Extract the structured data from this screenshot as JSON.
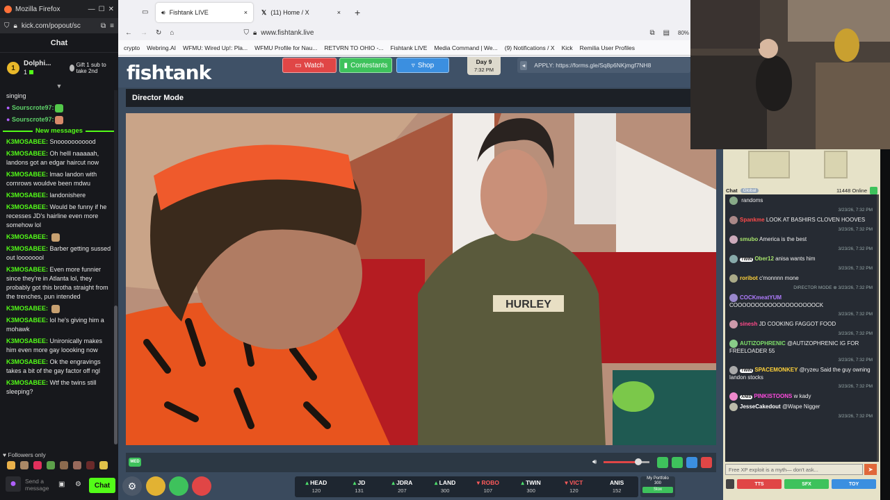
{
  "kick": {
    "window_title": "Mozilla Firefox",
    "url": "kick.com/popout/sc",
    "header": "Chat",
    "pinned": {
      "rank": "1",
      "user": "Dolphi...",
      "count": "1",
      "gift_text": "Gift 1 sub to take 2nd"
    },
    "pre_messages": [
      {
        "user": "",
        "text": "singing"
      },
      {
        "user": "Sourscrote97:",
        "text": ""
      },
      {
        "user": "Sourscrote97:",
        "text": ""
      }
    ],
    "new_messages_label": "New messages",
    "messages": [
      {
        "user": "K3MOSABEE:",
        "text": "Snooooooooood"
      },
      {
        "user": "K3MOSABEE:",
        "text": "Oh helll naaaaah, landons got an edgar haircut now"
      },
      {
        "user": "K3MOSABEE:",
        "text": "lmao landon with cornrows wouldve been mdwu"
      },
      {
        "user": "K3MOSABEE:",
        "text": "landonishere"
      },
      {
        "user": "K3MOSABEE:",
        "text": "Would be funny if he recesses JD's hairline even more somehow lol"
      },
      {
        "user": "K3MOSABEE:",
        "text": ""
      },
      {
        "user": "K3MOSABEE:",
        "text": "Barber getting sussed out loooooool"
      },
      {
        "user": "K3MOSABEE:",
        "text": "Even more funnier since they're in Atlanta lol, they probably got this brotha straight from the trenches, pun intended"
      },
      {
        "user": "K3MOSABEE:",
        "text": ""
      },
      {
        "user": "K3MOSABEE:",
        "text": "lol he's giving him a mohawk"
      },
      {
        "user": "K3MOSABEE:",
        "text": "Unironically makes him even more gay loooking now"
      },
      {
        "user": "K3MOSABEE:",
        "text": "Ok the engravings takes a bit of the gay factor off ngl"
      },
      {
        "user": "K3MOSABEE:",
        "text": "Wtf the twins still sleeping?"
      }
    ],
    "followers_only": "Followers only",
    "send_placeholder": "Send a message",
    "chat_button": "Chat"
  },
  "browser": {
    "tabs": [
      {
        "title": "Fishtank LIVE",
        "close": "×"
      },
      {
        "title": "(11) Home / X",
        "close": "×"
      }
    ],
    "new_tab": "+",
    "url": "www.fishtank.live",
    "zoom": "80%",
    "bookmarks": [
      "crypto",
      "Webring.AI",
      "WFMU: Wired Up!: Pla...",
      "WFMU Profile for Nau...",
      "RETVRN TO OHIO -...",
      "Fishtank LIVE",
      "Media Command | We...",
      "(9) Notifications / X",
      "Kick",
      "Remilia User Profiles"
    ]
  },
  "fishtank": {
    "logo": "fishtank",
    "nav": {
      "watch": "Watch",
      "contestants": "Contestants",
      "shop": "Shop"
    },
    "day": {
      "label": "Day 9",
      "date": "7:32 PM"
    },
    "apply": "APPLY: https://forms.gle/Sq8p6NKjmgf7NH8",
    "mode_title": "Director Mode",
    "quality": "MED",
    "contestants": [
      {
        "name": "HEAD",
        "value": "120",
        "dir": "up"
      },
      {
        "name": "JD",
        "value": "131",
        "dir": "up"
      },
      {
        "name": "JDRA",
        "value": "207",
        "dir": "up"
      },
      {
        "name": "LAND",
        "value": "300",
        "dir": "up"
      },
      {
        "name": "ROBO",
        "value": "107",
        "dir": "down"
      },
      {
        "name": "TWIN",
        "value": "300",
        "dir": "up"
      },
      {
        "name": "VICT",
        "value": "120",
        "dir": "down"
      },
      {
        "name": "ANIS",
        "value": "152",
        "dir": "none"
      }
    ],
    "portfolio": {
      "label": "My Portfolio",
      "value": "300",
      "button": "Stox"
    },
    "chat": {
      "title": "Chat",
      "tab": "Global",
      "online": "11448 Online",
      "messages": [
        {
          "badge": "",
          "user": "",
          "text": "randoms",
          "ts": "3/23/26, 7:32 PM",
          "color": "#ffffff"
        },
        {
          "badge": "",
          "user": "Spankme",
          "text": "LOOK AT BASHIRS CLOVEN HOOVES",
          "ts": "3/23/26, 7:32 PM",
          "color": "#ff4a4a"
        },
        {
          "badge": "",
          "user": "smubo",
          "text": "America is the best",
          "ts": "3/23/26, 7:32 PM",
          "color": "#a6e36b"
        },
        {
          "badge": "TWIN",
          "user": "Ober12",
          "text": "anisa wants him",
          "ts": "3/23/26, 7:32 PM",
          "color": "#a6e36b"
        },
        {
          "badge": "",
          "user": "roribot",
          "text": "c'monnnn mone",
          "ts": "DIRECTOR MODE ⊕ 3/23/26, 7:32 PM",
          "color": "#ffd23a"
        },
        {
          "badge": "",
          "user": "COCKmeatYUM",
          "text": "COOOOOOOOOOOOOOOOOOOCK",
          "ts": "3/23/26, 7:32 PM",
          "color": "#b07cff"
        },
        {
          "badge": "",
          "user": "sinesh",
          "text": "JD COOKING FAGGOT FOOD",
          "ts": "3/23/26, 7:32 PM",
          "color": "#ff4a8a"
        },
        {
          "badge": "",
          "user": "AUTIZOPHRENIC",
          "text": "@AUTIZOPHRENIC IG FOR FREELOADER 55",
          "ts": "3/23/26, 7:32 PM",
          "color": "#7fe06b"
        },
        {
          "badge": "TWIN",
          "user": "SPACEMONKEY",
          "text": "@ryzeu Said the guy owning landon stocks",
          "ts": "3/23/26, 7:32 PM",
          "color": "#ffd23a"
        },
        {
          "badge": "ANIS",
          "user": "PINKISTOONS",
          "text": "w kady",
          "ts": "",
          "color": "#ff4adf"
        },
        {
          "badge": "",
          "user": "JesseCakedout",
          "text": "@Wape Nigger",
          "ts": "3/23/26, 7:32 PM",
          "color": "#ffffff"
        }
      ],
      "input_placeholder": "Free XP exploit is a myth— don't ask...",
      "buttons": {
        "tts": "TTS",
        "sfx": "SFX",
        "toy": "TOY"
      }
    }
  }
}
